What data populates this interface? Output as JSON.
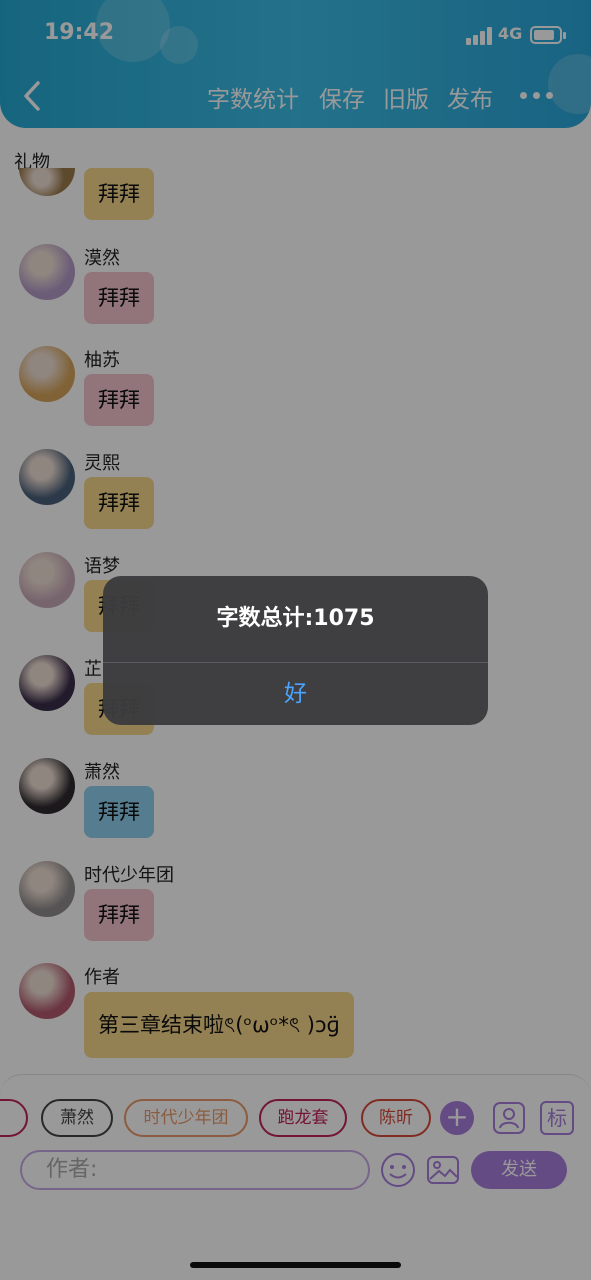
{
  "status_bar": {
    "time": "19:42",
    "network": "4G"
  },
  "nav": {
    "word_count": "字数统计",
    "save": "保存",
    "old_version": "旧版",
    "publish": "发布"
  },
  "section_title": "礼物",
  "messages": [
    {
      "name": "",
      "text": "拜拜",
      "bubble_color": "#f5d58a",
      "avatar_color": "#9b7a4a"
    },
    {
      "name": "漠然",
      "text": "拜拜",
      "bubble_color": "#f4c2cd",
      "avatar_color": "#b39ac8"
    },
    {
      "name": "柚苏",
      "text": "拜拜",
      "bubble_color": "#f4c2cd",
      "avatar_color": "#d6a45a"
    },
    {
      "name": "灵熙",
      "text": "拜拜",
      "bubble_color": "#f5d58a",
      "avatar_color": "#4a607a"
    },
    {
      "name": "语梦",
      "text": "拜拜",
      "bubble_color": "#f5d58a",
      "avatar_color": "#c7a9b8"
    },
    {
      "name": "芷",
      "text": "拜拜",
      "bubble_color": "#f5d58a",
      "avatar_color": "#3a2d4a"
    },
    {
      "name": "萧然",
      "text": "拜拜",
      "bubble_color": "#8fd0ef",
      "avatar_color": "#2e2a2e"
    },
    {
      "name": "时代少年团",
      "text": "拜拜",
      "bubble_color": "#f4c2cd",
      "avatar_color": "#8e8a8a"
    },
    {
      "name": "作者",
      "text": "第三章结束啦ৎ(ᵒωᵒ*ৎ )ɔɡ̈",
      "bubble_color": "#f5d58a",
      "avatar_color": "#b35b6f"
    }
  ],
  "chips": [
    {
      "label": "萧然",
      "color": "#444444"
    },
    {
      "label": "时代少年团",
      "color": "#e89a6a"
    },
    {
      "label": "跑龙套",
      "color": "#c2225a"
    },
    {
      "label": "陈昕",
      "color": "#d84a3a"
    }
  ],
  "input": {
    "placeholder": "作者:"
  },
  "send_label": "发送",
  "tag_icon_label": "标",
  "alert": {
    "title": "字数总计:1075",
    "ok": "好"
  },
  "colors": {
    "header": "#3bbde6",
    "accent": "#a77ddd",
    "link": "#4aa3ff"
  }
}
